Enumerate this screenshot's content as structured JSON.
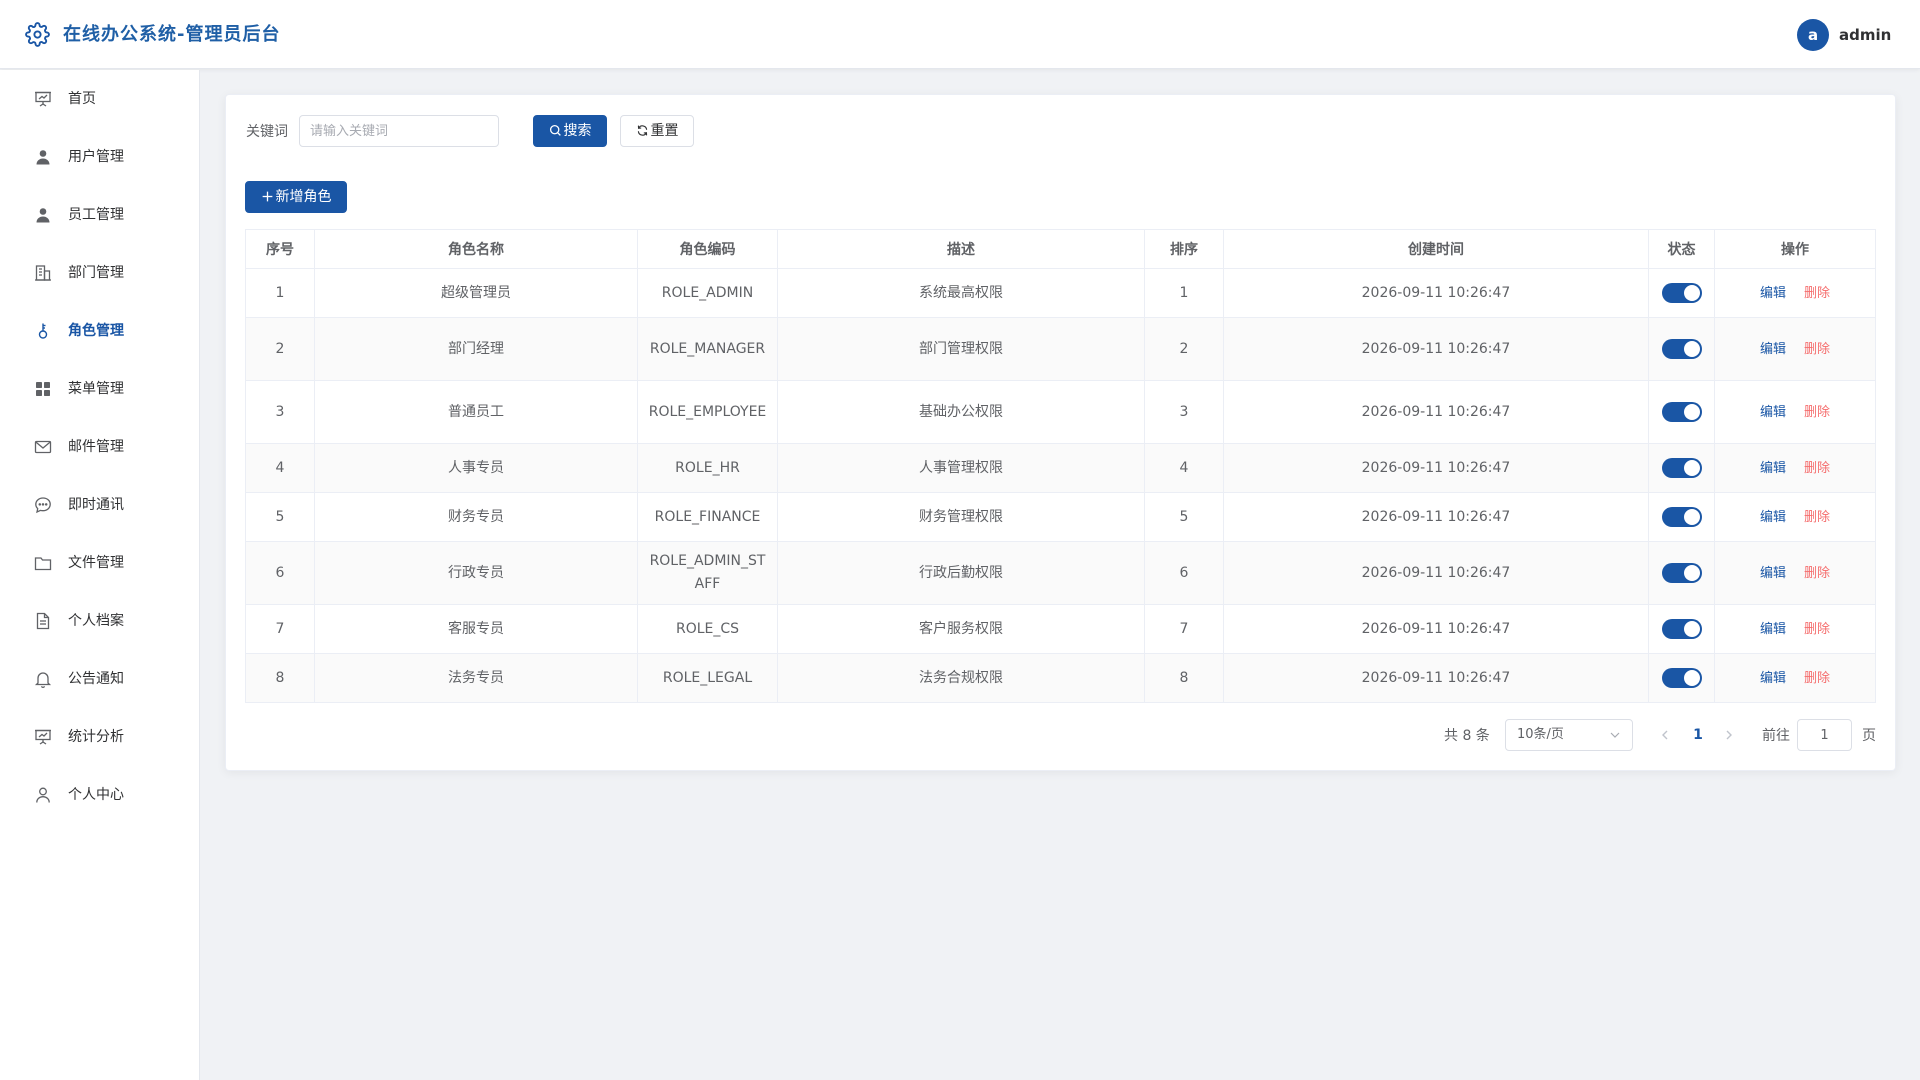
{
  "header": {
    "title": "在线办公系统-管理员后台",
    "avatar_letter": "a",
    "username": "admin"
  },
  "sidebar": {
    "items": [
      {
        "label": "首页",
        "icon": "presentation-icon"
      },
      {
        "label": "用户管理",
        "icon": "user-icon"
      },
      {
        "label": "员工管理",
        "icon": "user-icon"
      },
      {
        "label": "部门管理",
        "icon": "office-building-icon"
      },
      {
        "label": "角色管理",
        "icon": "key-icon",
        "active": true
      },
      {
        "label": "菜单管理",
        "icon": "grid-icon"
      },
      {
        "label": "邮件管理",
        "icon": "mail-icon"
      },
      {
        "label": "即时通讯",
        "icon": "chat-icon"
      },
      {
        "label": "文件管理",
        "icon": "folder-icon"
      },
      {
        "label": "个人档案",
        "icon": "document-icon"
      },
      {
        "label": "公告通知",
        "icon": "bell-icon"
      },
      {
        "label": "统计分析",
        "icon": "presentation-icon"
      },
      {
        "label": "个人中心",
        "icon": "user-outline-icon"
      }
    ]
  },
  "search": {
    "label": "关键词",
    "placeholder": "请输入关键词",
    "value": "",
    "search_label": "搜索",
    "reset_label": "重置"
  },
  "toolbar": {
    "add_label": "新增角色"
  },
  "table": {
    "headers": [
      "序号",
      "角色名称",
      "角色编码",
      "描述",
      "排序",
      "创建时间",
      "状态",
      "操作"
    ],
    "edit_label": "编辑",
    "delete_label": "删除",
    "rows": [
      {
        "index": "1",
        "name": "超级管理员",
        "code": "ROLE_ADMIN",
        "desc": "系统最高权限",
        "sort": "1",
        "created": "2026-09-11 10:26:47",
        "enabled": true
      },
      {
        "index": "2",
        "name": "部门经理",
        "code": "ROLE_MANAGER",
        "desc": "部门管理权限",
        "sort": "2",
        "created": "2026-09-11 10:26:47",
        "enabled": true
      },
      {
        "index": "3",
        "name": "普通员工",
        "code": "ROLE_EMPLOYEE",
        "desc": "基础办公权限",
        "sort": "3",
        "created": "2026-09-11 10:26:47",
        "enabled": true
      },
      {
        "index": "4",
        "name": "人事专员",
        "code": "ROLE_HR",
        "desc": "人事管理权限",
        "sort": "4",
        "created": "2026-09-11 10:26:47",
        "enabled": true
      },
      {
        "index": "5",
        "name": "财务专员",
        "code": "ROLE_FINANCE",
        "desc": "财务管理权限",
        "sort": "5",
        "created": "2026-09-11 10:26:47",
        "enabled": true
      },
      {
        "index": "6",
        "name": "行政专员",
        "code": "ROLE_ADMIN_STAFF",
        "desc": "行政后勤权限",
        "sort": "6",
        "created": "2026-09-11 10:26:47",
        "enabled": true
      },
      {
        "index": "7",
        "name": "客服专员",
        "code": "ROLE_CS",
        "desc": "客户服务权限",
        "sort": "7",
        "created": "2026-09-11 10:26:47",
        "enabled": true
      },
      {
        "index": "8",
        "name": "法务专员",
        "code": "ROLE_LEGAL",
        "desc": "法务合规权限",
        "sort": "8",
        "created": "2026-09-11 10:26:47",
        "enabled": true
      }
    ]
  },
  "pagination": {
    "total_label": "共 8 条",
    "page_size": "10条/页",
    "current_page": "1",
    "goto_label": "前往",
    "goto_value": "1",
    "page_suffix": "页"
  },
  "colors": {
    "primary": "#1a56a5",
    "danger": "#f56c6c",
    "background": "#f0f2f5"
  }
}
